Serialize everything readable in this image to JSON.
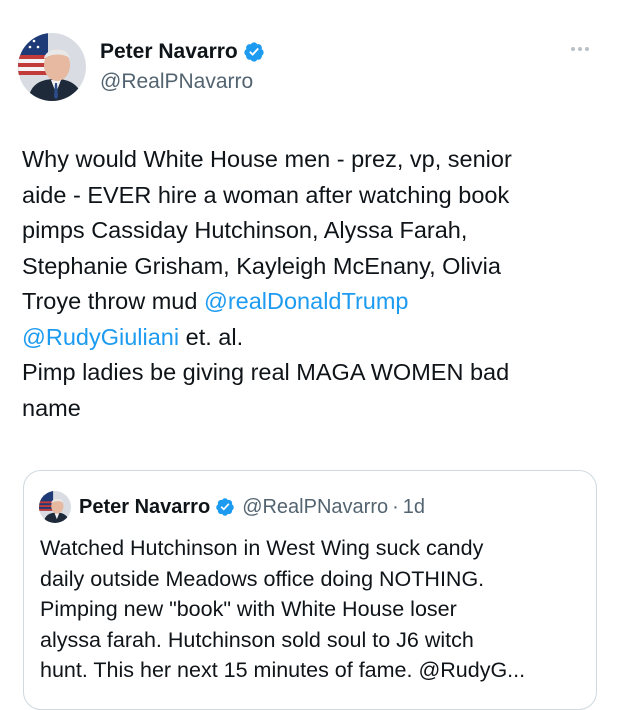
{
  "tweet": {
    "author_name": "Peter Navarro",
    "author_handle": "@RealPNavarro",
    "text_lines": [
      [
        {
          "t": "Why would White House men - prez, vp, senior"
        }
      ],
      [
        {
          "t": "aide - EVER hire a woman after watching book"
        }
      ],
      [
        {
          "t": "pimps Cassiday Hutchinson, Alyssa Farah,"
        }
      ],
      [
        {
          "t": "Stephanie Grisham, Kayleigh McEnany, Olivia"
        }
      ],
      [
        {
          "t": "Troye throw mud "
        },
        {
          "t": "@realDonaldTrump",
          "mention": true
        }
      ],
      [
        {
          "t": "@RudyGiuliani",
          "mention": true
        },
        {
          "t": " et. al."
        }
      ],
      [
        {
          "t": "Pimp ladies be giving real MAGA WOMEN bad"
        }
      ],
      [
        {
          "t": "name"
        }
      ]
    ]
  },
  "quoted_tweet": {
    "author_name": "Peter Navarro",
    "author_handle": "@RealPNavarro",
    "separator": "·",
    "time": "1d",
    "text_lines": [
      "Watched Hutchinson in West Wing suck candy",
      "daily outside Meadows office doing NOTHING.",
      "Pimping  new \"book\" with White House loser",
      "alyssa farah.  Hutchinson sold soul to J6 witch",
      "hunt.  This her next 15 minutes of fame.  @RudyG..."
    ]
  },
  "icons": {
    "verified": "verified-badge-icon",
    "more": "more-options-icon"
  },
  "colors": {
    "text": "#0f1419",
    "secondary": "#536471",
    "link": "#1d9bf0",
    "verified": "#1d9bf0",
    "border": "#cfd9de"
  }
}
